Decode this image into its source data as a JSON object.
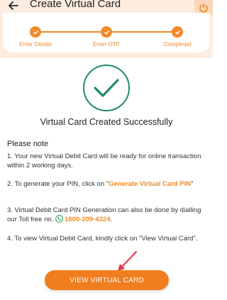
{
  "header": {
    "title": "Create Virtual Card",
    "back_icon": "back-arrow-icon",
    "power_icon": "power-icon",
    "background": "#fdece0"
  },
  "stepper": {
    "steps": [
      {
        "label": "Enter Details",
        "status": "completed"
      },
      {
        "label": "Enter OTP",
        "status": "completed"
      },
      {
        "label": "Completed",
        "status": "completed"
      }
    ],
    "accent": "#f08a2a"
  },
  "success": {
    "icon": "checkmark-icon",
    "title": "Virtual Card Created Successfully",
    "color": "#1f8a6c"
  },
  "notes": {
    "heading": "Please note",
    "note1": "1. Your new Virtual Debit Card will be ready for online transaction within 2 working days.",
    "note2_prefix": "2. To generate your PIN, click on \"",
    "note2_link": "Generate Virtual Card PIN",
    "note2_suffix": "\"",
    "note3_prefix": "3. Virtual Debit Card PIN Generation can also be done by dialling our Toll free no. ",
    "note3_phone": "1800-209-4324",
    "note3_suffix": ".",
    "note4": "4. To view Virtual Debit Card, kindly click on \"View Virtual Card\"."
  },
  "actions": {
    "view_button": "VIEW VIRTUAL CARD",
    "button_color": "#f07d1e"
  }
}
